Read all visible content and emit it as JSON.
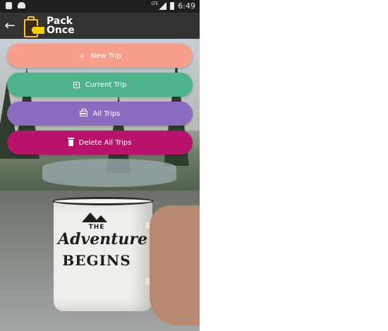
{
  "status_bar": {
    "network": "LTE",
    "time": "6:49"
  },
  "app_bar": {
    "back_icon": "arrow-back-icon",
    "logo_icon": "suitcase-tag-logo",
    "title_line1": "Pack",
    "title_line2": "Once"
  },
  "actions": [
    {
      "label": "New Trip",
      "icon": "plus-icon",
      "color": "#F79F8C"
    },
    {
      "label": "Current Trip",
      "icon": "play-box-icon",
      "color": "#4DB38C"
    },
    {
      "label": "All Trips",
      "icon": "briefcase-icon",
      "color": "#8A6CC1"
    },
    {
      "label": "Delete All Trips",
      "icon": "trash-icon",
      "color": "#B8126B"
    }
  ],
  "background_mug": {
    "line1": "THE",
    "line2": "Adventure",
    "line3": "BEGINS"
  }
}
